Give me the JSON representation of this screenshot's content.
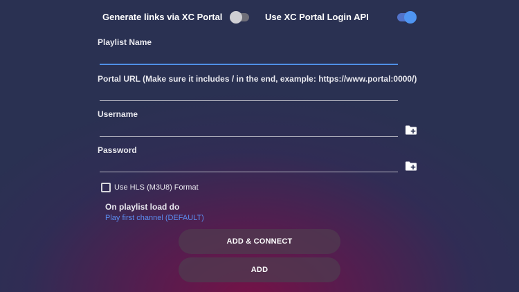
{
  "toggles": {
    "generate_links_label": "Generate links via XC Portal",
    "generate_links_on": false,
    "login_api_label": "Use XC Portal Login API",
    "login_api_on": true
  },
  "fields": {
    "playlist_name": {
      "label": "Playlist Name",
      "value": ""
    },
    "portal_url": {
      "label": "Portal URL (Make sure it includes / in the end, example: https://www.portal:0000/)",
      "value": ""
    },
    "username": {
      "label": "Username",
      "value": ""
    },
    "password": {
      "label": "Password",
      "value": ""
    }
  },
  "hls_checkbox": {
    "label": "Use HLS (M3U8) Format",
    "checked": false
  },
  "playlist_load": {
    "title": "On playlist load do",
    "selected": "Play first channel (DEFAULT)"
  },
  "buttons": {
    "add_connect": "ADD & CONNECT",
    "add": "ADD"
  },
  "icons": {
    "username_picker": "folder-plus-icon",
    "password_picker": "folder-plus-icon"
  },
  "colors": {
    "accent": "#4f95f2",
    "link": "#5b8df0",
    "background": "#2a3152",
    "button_bg": "#503a50"
  }
}
